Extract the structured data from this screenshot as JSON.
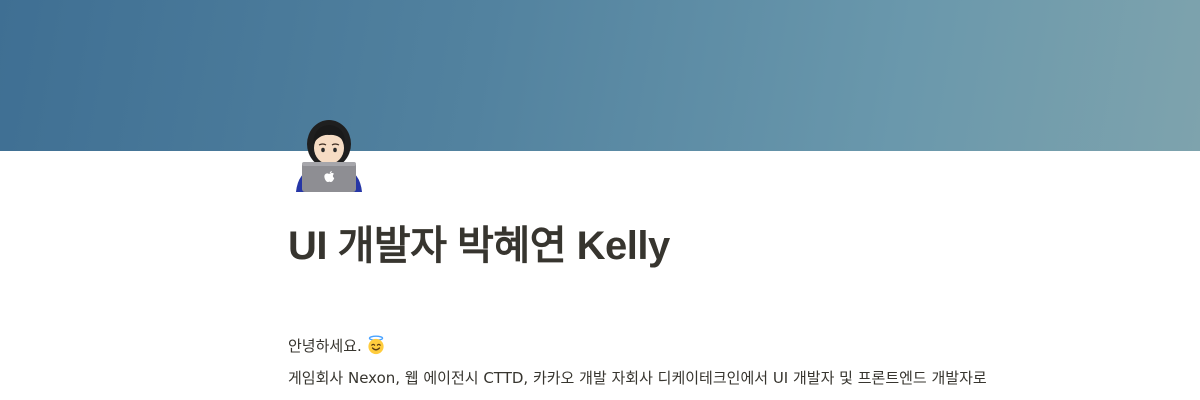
{
  "cover": {
    "gradient_start": "#3f6f93",
    "gradient_end": "#7ea3ad"
  },
  "page": {
    "icon": "woman-technologist-emoji",
    "title": "UI 개발자 박혜연 Kelly"
  },
  "body": {
    "greeting": "안녕하세요.",
    "greeting_emoji": "smiling-face-with-halo-emoji",
    "intro": "게임회사 Nexon, 웹 에이전시 CTTD, 카카오 개발 자회사 디케이테크인에서 UI 개발자 및 프론트엔드 개발자로"
  }
}
